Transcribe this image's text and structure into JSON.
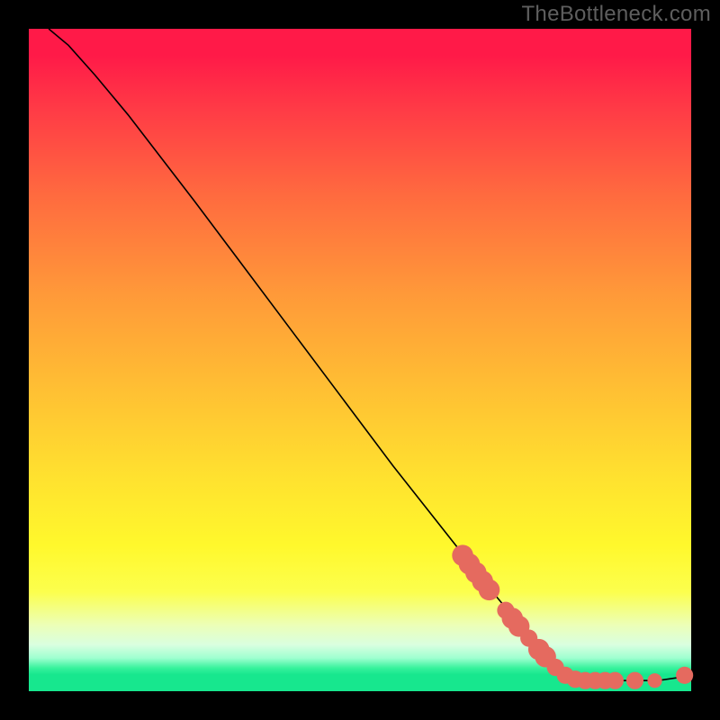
{
  "watermark": "TheBottleneck.com",
  "chart_data": {
    "type": "line",
    "title": "",
    "xlabel": "",
    "ylabel": "",
    "xlim": [
      0,
      100
    ],
    "ylim": [
      0,
      100
    ],
    "curve": {
      "name": "bottleneck-curve",
      "points": [
        {
          "x": 3,
          "y": 100
        },
        {
          "x": 6,
          "y": 97.5
        },
        {
          "x": 10,
          "y": 93
        },
        {
          "x": 15,
          "y": 87
        },
        {
          "x": 25,
          "y": 74
        },
        {
          "x": 40,
          "y": 54
        },
        {
          "x": 55,
          "y": 34
        },
        {
          "x": 70,
          "y": 15
        },
        {
          "x": 80,
          "y": 3
        },
        {
          "x": 82,
          "y": 2
        },
        {
          "x": 85,
          "y": 1.6
        },
        {
          "x": 90,
          "y": 1.6
        },
        {
          "x": 95,
          "y": 1.6
        },
        {
          "x": 99,
          "y": 2.2
        }
      ]
    },
    "markers": {
      "name": "highlighted-segment",
      "color": "#e56a5f",
      "points": [
        {
          "x": 65.5,
          "y": 20.5,
          "r": 1.6
        },
        {
          "x": 66.5,
          "y": 19.2,
          "r": 1.6
        },
        {
          "x": 67.5,
          "y": 17.9,
          "r": 1.6
        },
        {
          "x": 68.5,
          "y": 16.6,
          "r": 1.6
        },
        {
          "x": 69.5,
          "y": 15.3,
          "r": 1.6
        },
        {
          "x": 72.0,
          "y": 12.2,
          "r": 1.3
        },
        {
          "x": 73.0,
          "y": 11.0,
          "r": 1.6
        },
        {
          "x": 74.0,
          "y": 9.8,
          "r": 1.6
        },
        {
          "x": 75.5,
          "y": 8.0,
          "r": 1.3
        },
        {
          "x": 77.0,
          "y": 6.3,
          "r": 1.6
        },
        {
          "x": 78.0,
          "y": 5.2,
          "r": 1.6
        },
        {
          "x": 79.5,
          "y": 3.6,
          "r": 1.3
        },
        {
          "x": 81.0,
          "y": 2.4,
          "r": 1.3
        },
        {
          "x": 82.5,
          "y": 1.8,
          "r": 1.3
        },
        {
          "x": 84.0,
          "y": 1.6,
          "r": 1.3
        },
        {
          "x": 85.5,
          "y": 1.6,
          "r": 1.3
        },
        {
          "x": 87.0,
          "y": 1.6,
          "r": 1.3
        },
        {
          "x": 88.5,
          "y": 1.6,
          "r": 1.3
        },
        {
          "x": 91.5,
          "y": 1.6,
          "r": 1.3
        },
        {
          "x": 94.5,
          "y": 1.6,
          "r": 1.1
        },
        {
          "x": 99.0,
          "y": 2.4,
          "r": 1.3
        }
      ]
    }
  }
}
